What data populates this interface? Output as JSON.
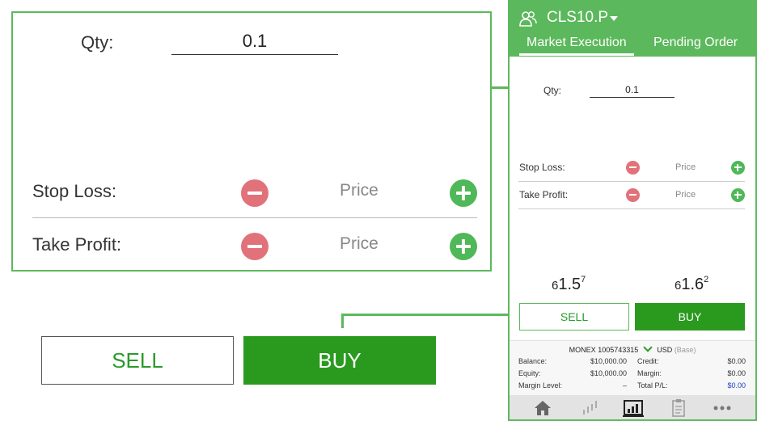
{
  "zoom": {
    "qty_label": "Qty:",
    "qty_value": "0.1",
    "stop_loss_label": "Stop Loss:",
    "take_profit_label": "Take Profit:",
    "price_placeholder": "Price",
    "sell_label": "SELL",
    "buy_label": "BUY"
  },
  "header": {
    "symbol": "CLS10.P",
    "tabs": [
      {
        "label": "Market Execution",
        "active": true
      },
      {
        "label": "Pending Order",
        "active": false
      }
    ]
  },
  "order": {
    "qty_label": "Qty:",
    "qty_value": "0.1",
    "stop_loss_label": "Stop Loss:",
    "take_profit_label": "Take Profit:",
    "price_placeholder": "Price"
  },
  "quotes": {
    "bid": {
      "prefix": "6",
      "main": "1.5",
      "sup": "7"
    },
    "ask": {
      "prefix": "6",
      "main": "1.6",
      "sup": "2"
    }
  },
  "actions": {
    "sell_label": "SELL",
    "buy_label": "BUY"
  },
  "account": {
    "broker": "MONEX",
    "number": "1005743315",
    "currency": "USD",
    "base_label": "(Base)",
    "balance_label": "Balance:",
    "balance": "$10,000.00",
    "equity_label": "Equity:",
    "equity": "$10,000.00",
    "margin_level_label": "Margin Level:",
    "margin_level": "–",
    "credit_label": "Credit:",
    "credit": "$0.00",
    "margin_label": "Margin:",
    "margin": "$0.00",
    "total_pl_label": "Total P/L:",
    "total_pl": "$0.00"
  },
  "colors": {
    "accent_green": "#5cb85c",
    "buy_green": "#2a9a1f",
    "minus_red": "#e2727a",
    "plus_green": "#4fb858",
    "pl_blue": "#1f3fbf"
  },
  "nav_icons": [
    "home-icon",
    "chart-icon",
    "trade-icon",
    "clipboard-icon",
    "more-icon"
  ]
}
